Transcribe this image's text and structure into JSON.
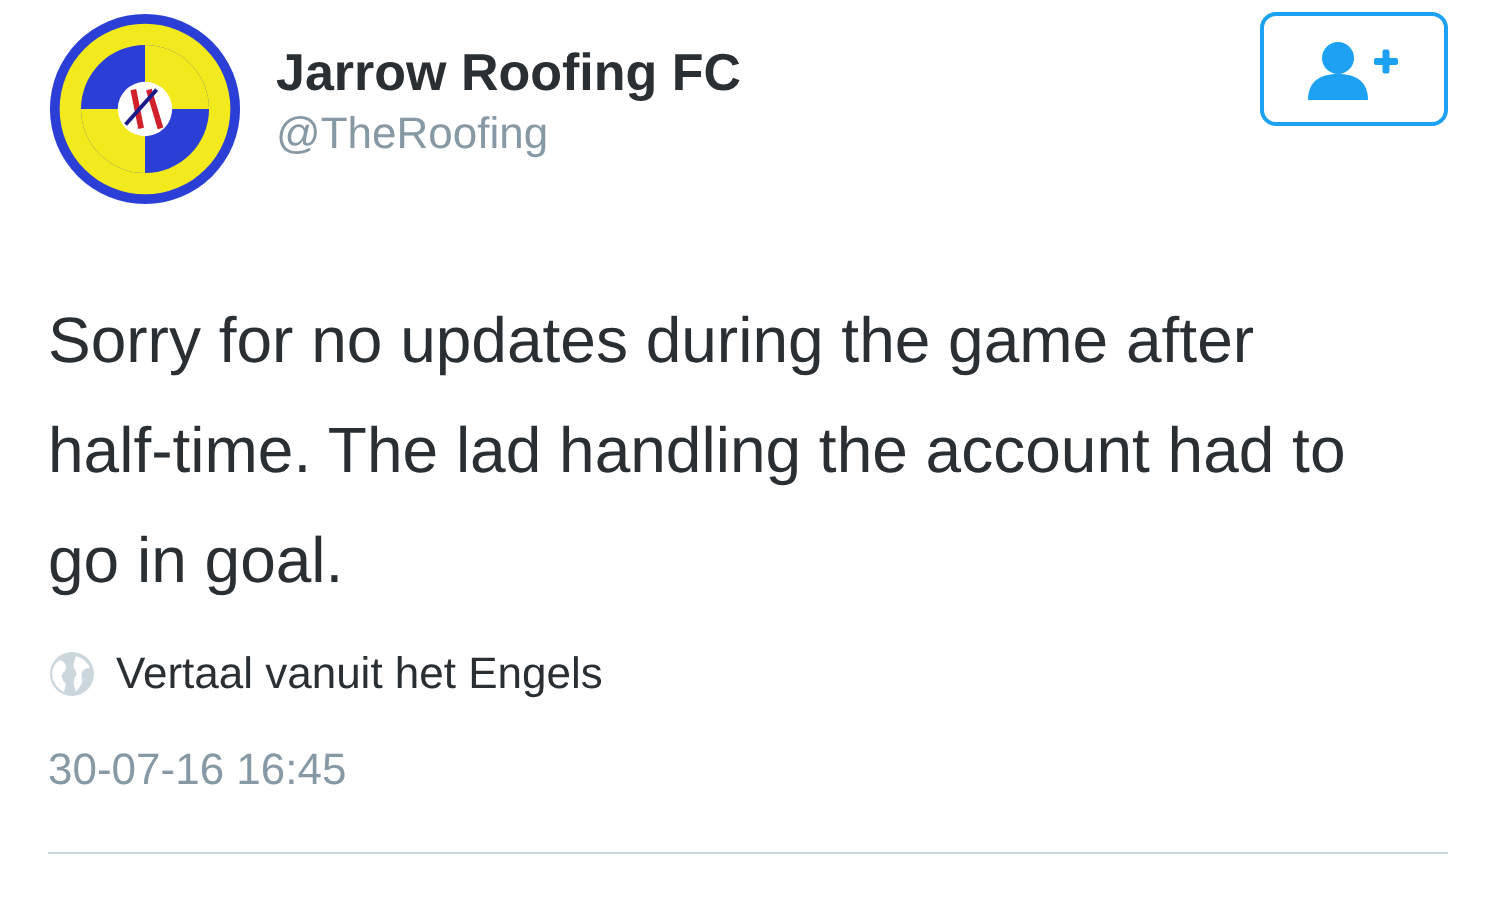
{
  "author": {
    "name": "Jarrow Roofing FC",
    "handle": "@TheRoofing"
  },
  "follow_button": {
    "following": false
  },
  "tweet": {
    "text": "Sorry for no updates during the game after half-time. The lad handling the account had to go in goal.",
    "translate": "Vertaal vanuit het Engels",
    "timestamp": "30-07-16 16:45"
  }
}
